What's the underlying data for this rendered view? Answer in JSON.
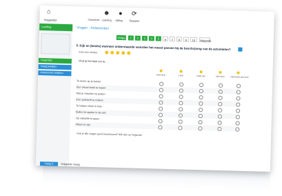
{
  "app": {
    "title": "Vragenlijst"
  },
  "toolbar": {
    "items": [
      {
        "icon": "home-icon",
        "glyph": "⌂",
        "label": "Overzicht"
      },
      {
        "icon": "user-icon",
        "glyph": "☻",
        "label": "Leerling"
      },
      {
        "icon": "info-icon",
        "glyph": "●",
        "label": "Uitleg"
      },
      {
        "icon": "refresh-icon",
        "glyph": "⟳",
        "label": "Stoppen"
      }
    ]
  },
  "sidebar": {
    "header": "Leerling",
    "items": [
      {
        "label": "Vragenlijst",
        "style": "green"
      },
      {
        "label": "Vraag bekijken",
        "style": "blue"
      },
      {
        "label": "Antwoorden bekijken",
        "style": "blue"
      }
    ]
  },
  "breadcrumb": "Vragen - Antwoorden",
  "pager": {
    "prev": "Vorige",
    "pages": [
      "1",
      "2",
      "3",
      "4",
      "5",
      "6",
      "7",
      "8",
      "9",
      "10"
    ],
    "next": "Volgende"
  },
  "question": "5. Kijk en (beslis) wanneer onderstaande woorden het meest passen bij de beschrijving van de activiteiten?",
  "hint": "Kies een smiley:",
  "subquestion": "Vind je het leuk om te...",
  "columns": [
    "Heel leuk",
    "Leuk",
    "Gaat wel",
    "Niet leuk",
    "Helemaal niet leuk"
  ],
  "rows": [
    "Te lezen op je kamer",
    "Een nieuw boek te kopen",
    "Met je vrienden te praten",
    "Een opdracht te maken",
    "Te helpen thuis in huis",
    "Buiten te spelen in de tuin",
    "Op vakantie te gaan",
    "Alleen te zijn"
  ],
  "footer_note": "Heb je alle vragen goed beantwoord? Klik dan op Volgende.",
  "footer": {
    "tab": "Vraag 5",
    "text": "Volgende vraag"
  },
  "colors": {
    "accent_green": "#2aaa3e",
    "accent_blue": "#2a8fd6",
    "smiley": "#f4c21f"
  }
}
